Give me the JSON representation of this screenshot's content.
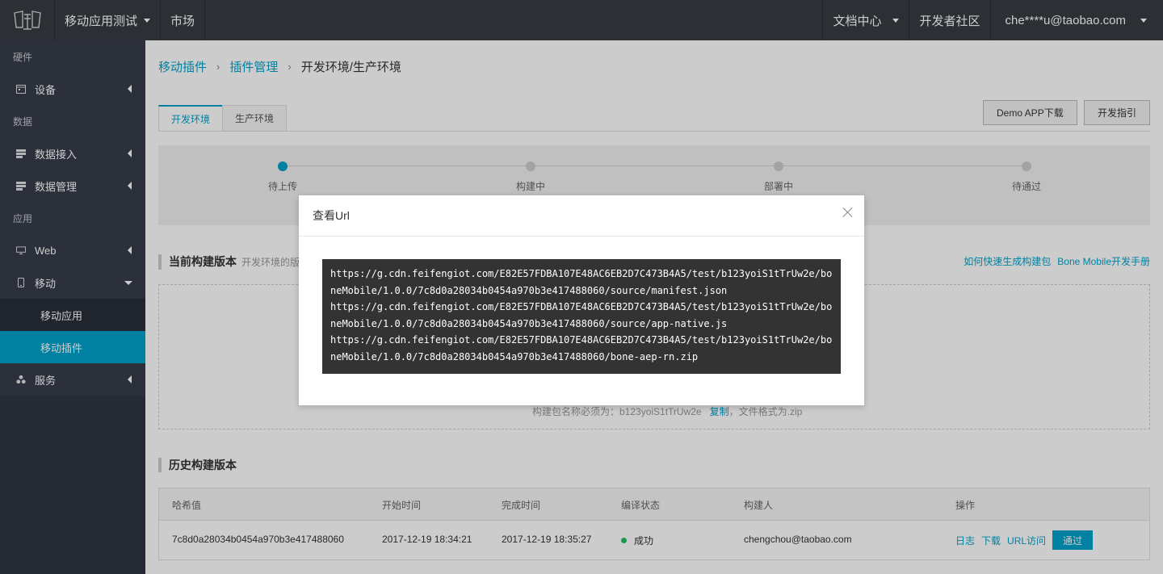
{
  "topbar": {
    "logo": "logo",
    "menu": [
      {
        "label": "移动应用测试",
        "has_caret": true
      },
      {
        "label": "市场",
        "has_caret": false
      }
    ],
    "right": [
      {
        "label": "文档中心",
        "has_caret": true
      },
      {
        "label": "开发者社区",
        "has_caret": false
      },
      {
        "label": "che****u@taobao.com",
        "has_caret": true
      }
    ]
  },
  "sidebar": {
    "groups": [
      {
        "title": "硬件",
        "items": [
          {
            "label": "设备",
            "icon": "device-icon"
          }
        ]
      },
      {
        "title": "数据",
        "items": [
          {
            "label": "数据接入",
            "icon": "data-icon"
          },
          {
            "label": "数据管理",
            "icon": "data-icon"
          }
        ]
      },
      {
        "title": "应用",
        "items": [
          {
            "label": "Web",
            "icon": "monitor-icon"
          },
          {
            "label": "移动",
            "icon": "phone-icon",
            "expanded": true
          }
        ]
      }
    ],
    "sub_items": [
      {
        "label": "移动应用",
        "active": false
      },
      {
        "label": "移动插件",
        "active": true
      }
    ],
    "service": {
      "label": "服务",
      "icon": "service-icon"
    }
  },
  "breadcrumb": {
    "items": [
      "移动插件",
      "插件管理"
    ],
    "current": "开发环境/生产环境",
    "separator": "›"
  },
  "tabs": [
    {
      "label": "开发环境",
      "active": true
    },
    {
      "label": "生产环境",
      "active": false
    }
  ],
  "buttons": {
    "demo": "Demo APP下载",
    "guide": "开发指引"
  },
  "steps": [
    "待上传",
    "构建中",
    "部署中",
    "待通过"
  ],
  "current_build": {
    "title": "当前构建版本",
    "subtitle": "开发环境的版",
    "links": [
      "如何快速生成构建包",
      "Bone Mobile开发手册"
    ],
    "note": "构建包名称必须为：b123yoiS1tTrUw2e",
    "copy": "复制",
    "note_suffix": "，文件格式为.zip"
  },
  "history": {
    "title": "历史构建版本",
    "columns": [
      "哈希值",
      "开始时间",
      "完成时间",
      "编译状态",
      "构建人",
      "操作"
    ],
    "rows": [
      {
        "hash": "7c8d0a28034b0454a970b3e417488060",
        "start": "2017-12-19 18:34:21",
        "end": "2017-12-19 18:35:27",
        "status": "成功",
        "builder": "chengchou@taobao.com",
        "ops": [
          "日志",
          "下载",
          "URL访问"
        ],
        "pass": "通过"
      }
    ]
  },
  "modal": {
    "title": "查看Url",
    "urls": [
      "https://g.cdn.feifengiot.com/E82E57FDBA107E48AC6EB2D7C473B4A5/test/b123yoiS1tTrUw2e/boneMobile/1.0.0/7c8d0a28034b0454a970b3e417488060/source/manifest.json",
      "https://g.cdn.feifengiot.com/E82E57FDBA107E48AC6EB2D7C473B4A5/test/b123yoiS1tTrUw2e/boneMobile/1.0.0/7c8d0a28034b0454a970b3e417488060/source/app-native.js",
      "https://g.cdn.feifengiot.com/E82E57FDBA107E48AC6EB2D7C473B4A5/test/b123yoiS1tTrUw2e/boneMobile/1.0.0/7c8d0a28034b0454a970b3e417488060/bone-aep-rn.zip"
    ]
  },
  "colors": {
    "accent": "#00a2ca",
    "topbar": "#373d41",
    "sidebar": "#2f3541",
    "success": "#1dbf60"
  }
}
